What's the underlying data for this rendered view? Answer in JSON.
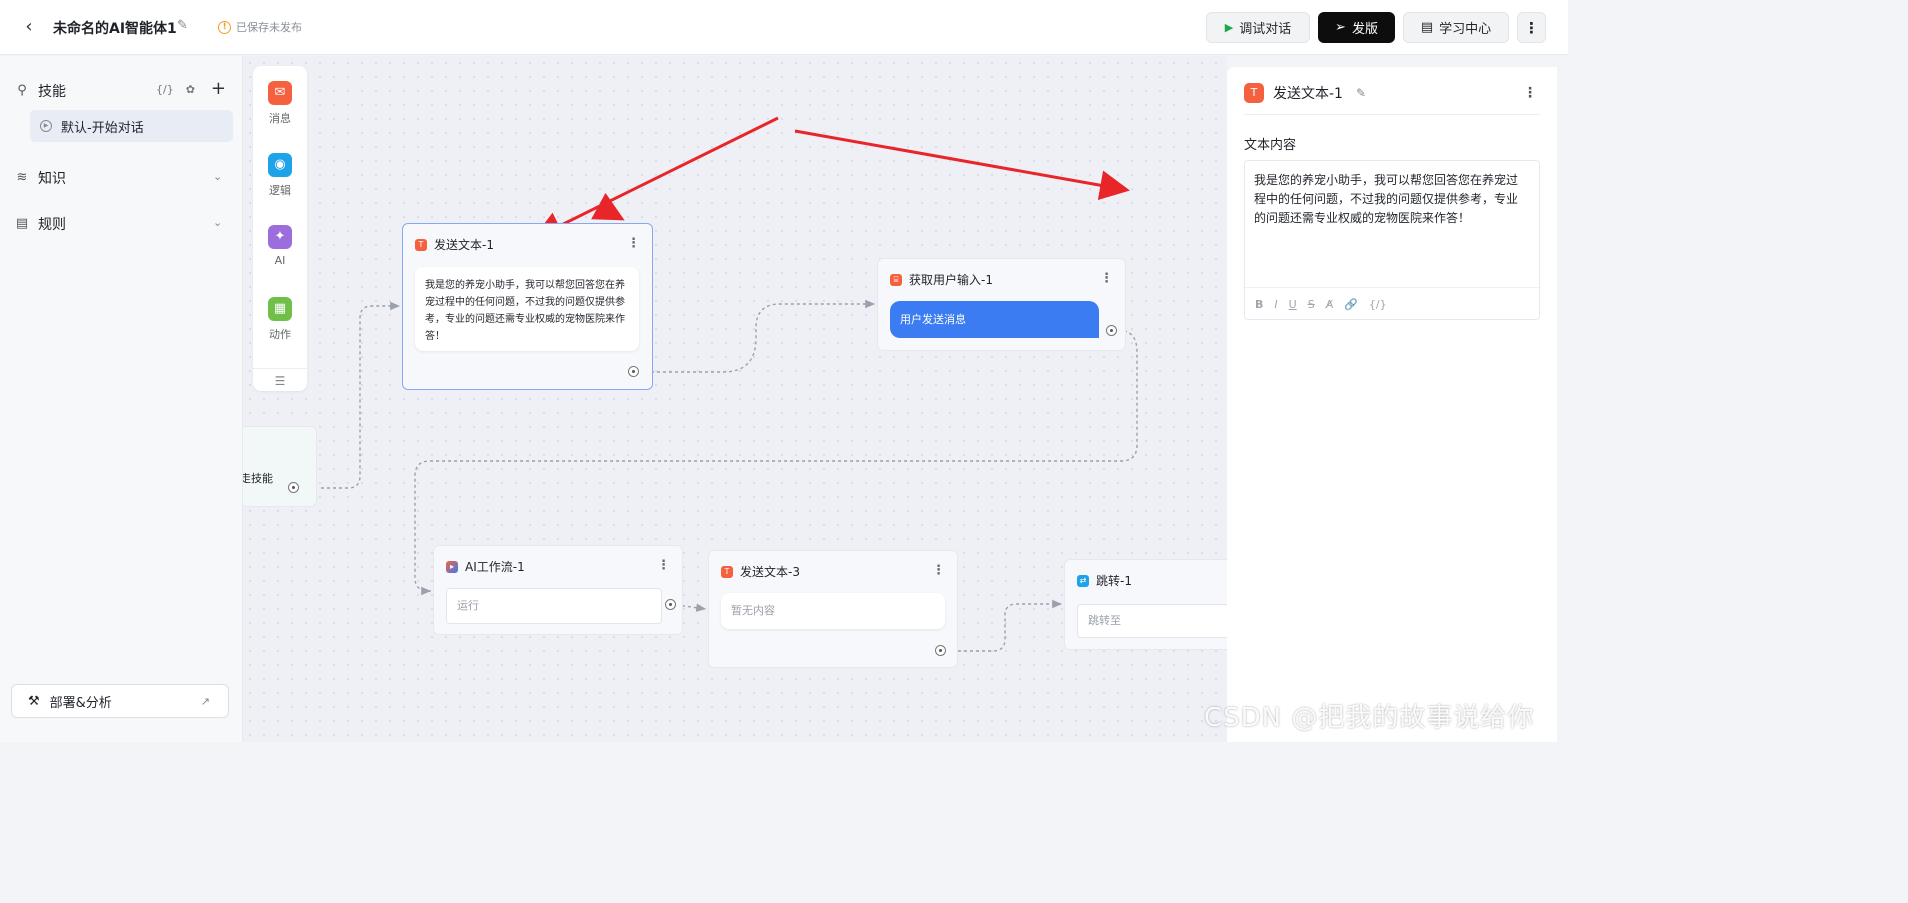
{
  "header": {
    "title": "未命名的AI智能体1",
    "save_status": "已保存未发布",
    "debug_label": "调试对话",
    "publish_label": "发版",
    "learn_label": "学习中心"
  },
  "sidebar": {
    "skill_label": "技能",
    "skill_item": "默认-开始对话",
    "knowledge_label": "知识",
    "rules_label": "规则",
    "deploy_label": "部署&分析"
  },
  "palette": {
    "items": [
      {
        "label": "消息",
        "icon": "message-icon"
      },
      {
        "label": "逻辑",
        "icon": "logic-icon"
      },
      {
        "label": "AI",
        "icon": "ai-icon"
      },
      {
        "label": "动作",
        "icon": "action-icon"
      }
    ]
  },
  "nodes": {
    "send_text_1": {
      "title": "发送文本-1",
      "content": "我是您的养宠小助手，我可以帮您回答您在养宠过程中的任何问题，不过我的问题仅提供参考，专业的问题还需专业权威的宠物医院来作答！"
    },
    "get_input_1": {
      "title": "获取用户输入-1",
      "pill": "用户发送消息"
    },
    "skill_start": {
      "label": "走技能"
    },
    "ai_flow_1": {
      "title": "AI工作流-1",
      "placeholder": "运行"
    },
    "send_text_3": {
      "title": "发送文本-3",
      "placeholder": "暂无内容"
    },
    "jump_1": {
      "title": "跳转-1",
      "placeholder": "跳转至"
    }
  },
  "panel": {
    "title": "发送文本-1",
    "section_label": "文本内容",
    "content": "我是您的养宠小助手，我可以帮您回答您在养宠过程中的任何问题，不过我的问题仅提供参考，专业的问题还需专业权威的宠物医院来作答！",
    "toolbar": [
      "B",
      "I",
      "U",
      "S",
      "A̸",
      "🔗",
      "{/}"
    ]
  },
  "watermark": "CSDN @把我的故事说给你",
  "colors": {
    "accent_blue": "#3b7cf2",
    "send_text_orange": "#f5613f",
    "annotation_red": "#e8262a",
    "publish_black": "#0d0d0d"
  }
}
